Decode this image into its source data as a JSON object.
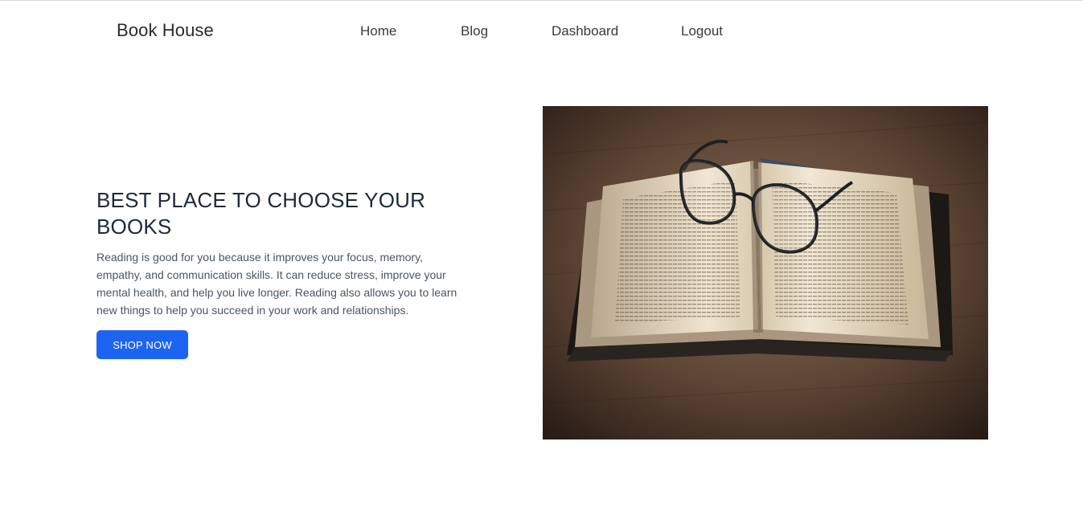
{
  "navbar": {
    "brand": "Book House",
    "links": [
      {
        "label": "Home"
      },
      {
        "label": "Blog"
      },
      {
        "label": "Dashboard"
      },
      {
        "label": "Logout"
      }
    ]
  },
  "hero": {
    "title": "BEST PLACE TO CHOOSE YOUR BOOKS",
    "description": "Reading is good for you because it improves your focus, memory, empathy, and communication skills. It can reduce stress, improve your mental health, and help you live longer. Reading also allows you to learn new things to help you succeed in your work and relationships.",
    "cta_label": "SHOP NOW",
    "image_subject": "open-book-with-reading-glasses-photo"
  },
  "colors": {
    "accent": "#1d64f2",
    "heading": "#1f2937",
    "body_text": "#4b5563",
    "nav_text": "#3a3a3a"
  }
}
